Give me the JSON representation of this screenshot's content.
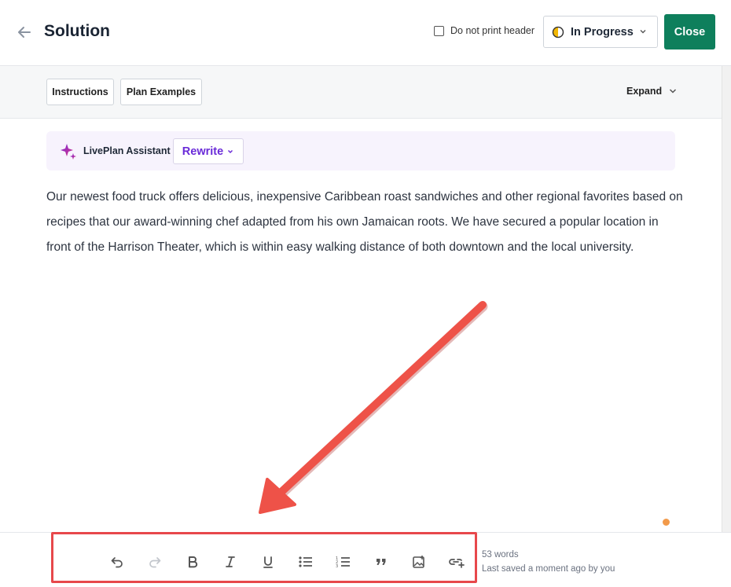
{
  "header": {
    "title": "Solution",
    "do_not_print_header": "Do not print header",
    "status": "In Progress",
    "close": "Close"
  },
  "toolbar": {
    "instructions": "Instructions",
    "plan_examples": "Plan Examples",
    "expand": "Expand"
  },
  "assistant": {
    "name": "LivePlan Assistant",
    "rewrite": "Rewrite"
  },
  "content": {
    "paragraph": "Our newest food truck offers delicious, inexpensive Caribbean roast sandwiches and other regional favorites based on recipes that our award-winning chef adapted from his own Jamaican roots. We have secured a popular location in front of the Harrison Theater, which is within easy walking distance of both downtown and the local university."
  },
  "footer": {
    "word_count": "53 words",
    "last_saved": "Last saved a moment ago by you"
  },
  "colors": {
    "primary_green": "#0e7f5c",
    "assistant_purple": "#6a2bd8",
    "annotation_red": "#e7484b",
    "status_yellow": "#f2b705"
  }
}
